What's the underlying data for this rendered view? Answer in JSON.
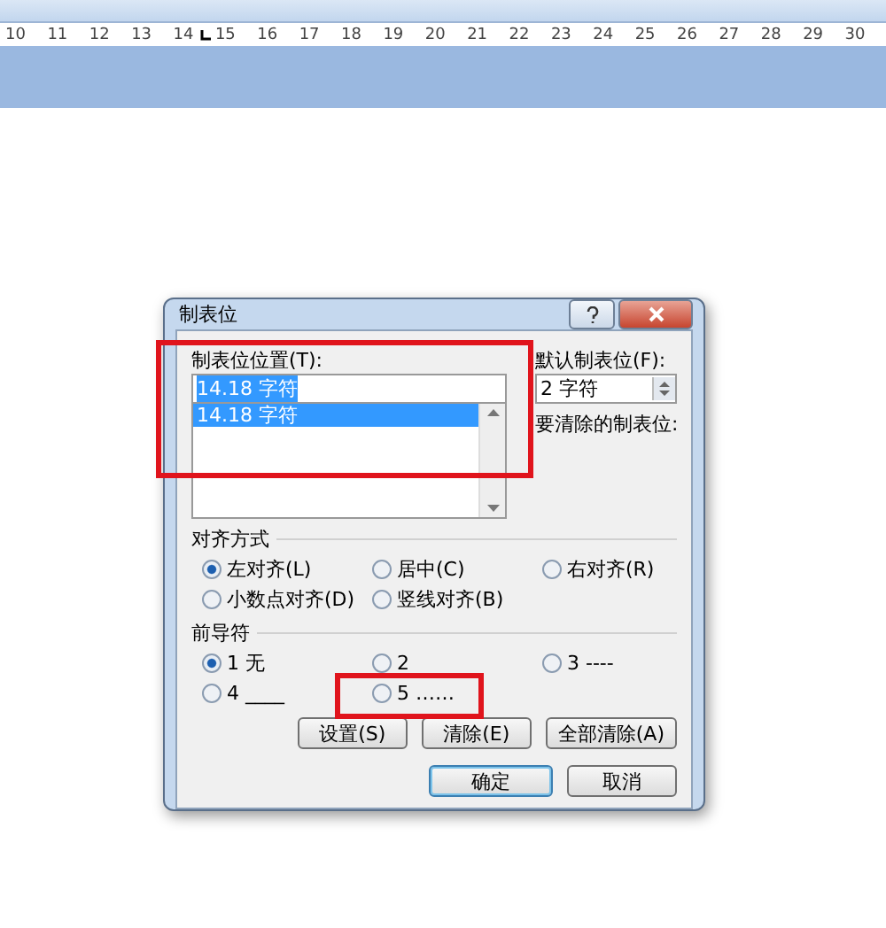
{
  "ruler": {
    "numbers": [
      {
        "label": "10",
        "tab_stop": false
      },
      {
        "label": "11",
        "tab_stop": false
      },
      {
        "label": "12",
        "tab_stop": false
      },
      {
        "label": "13",
        "tab_stop": false
      },
      {
        "label": "14",
        "tab_stop": true
      },
      {
        "label": "15",
        "tab_stop": false
      },
      {
        "label": "16",
        "tab_stop": false
      },
      {
        "label": "17",
        "tab_stop": false
      },
      {
        "label": "18",
        "tab_stop": false
      },
      {
        "label": "19",
        "tab_stop": false
      },
      {
        "label": "20",
        "tab_stop": false
      },
      {
        "label": "21",
        "tab_stop": false
      },
      {
        "label": "22",
        "tab_stop": false
      },
      {
        "label": "23",
        "tab_stop": false
      },
      {
        "label": "24",
        "tab_stop": false
      },
      {
        "label": "25",
        "tab_stop": false
      },
      {
        "label": "26",
        "tab_stop": false
      },
      {
        "label": "27",
        "tab_stop": false
      },
      {
        "label": "28",
        "tab_stop": false
      },
      {
        "label": "29",
        "tab_stop": false
      },
      {
        "label": "30",
        "tab_stop": false
      }
    ]
  },
  "dialog": {
    "title": "制表位",
    "position_label": "制表位位置(T):",
    "position_value": "14.18 字符",
    "positions": [
      {
        "label": "14.18 字符",
        "selected": true
      }
    ],
    "default_label": "默认制表位(F):",
    "default_value": "2 字符",
    "clear_label": "要清除的制表位:",
    "alignment_title": "对齐方式",
    "alignment": [
      {
        "label": "左对齐(L)",
        "selected": true
      },
      {
        "label": "居中(C)",
        "selected": false
      },
      {
        "label": "右对齐(R)",
        "selected": false
      },
      {
        "label": "小数点对齐(D)",
        "selected": false
      },
      {
        "label": "竖线对齐(B)",
        "selected": false
      }
    ],
    "leader_title": "前导符",
    "leaders": [
      {
        "label": "1 无",
        "selected": true
      },
      {
        "label": "2",
        "selected": false
      },
      {
        "label": "3 ----",
        "selected": false
      },
      {
        "label": "4 ____",
        "selected": false
      },
      {
        "label": "5 ……",
        "selected": false
      }
    ],
    "action_buttons": [
      "设置(S)",
      "清除(E)",
      "全部清除(A)"
    ],
    "ok": "确定",
    "cancel": "取消"
  }
}
